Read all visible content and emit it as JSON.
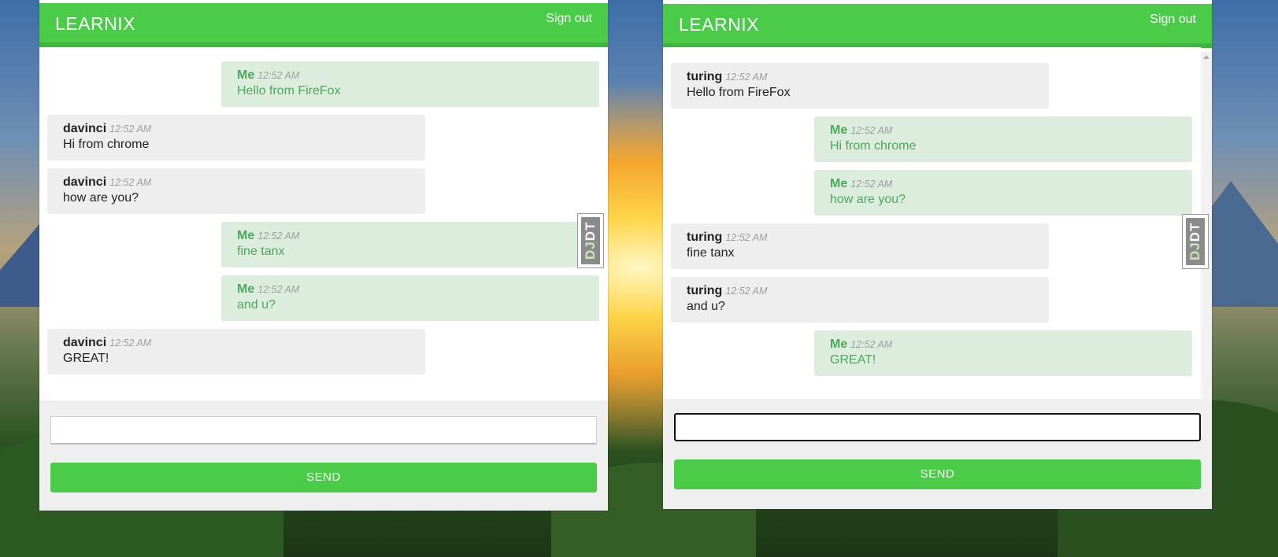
{
  "left_window": {
    "brand": "LEARNIX",
    "signout_label": "Sign out",
    "messages": [
      {
        "sender": "Me",
        "time": "12:52 AM",
        "text": "Hello from FireFox"
      },
      {
        "sender": "davinci",
        "time": "12:52 AM",
        "text": "Hi from chrome"
      },
      {
        "sender": "davinci",
        "time": "12:52 AM",
        "text": "how are you?"
      },
      {
        "sender": "Me",
        "time": "12:52 AM",
        "text": "fine tanx"
      },
      {
        "sender": "Me",
        "time": "12:52 AM",
        "text": "and u?"
      },
      {
        "sender": "davinci",
        "time": "12:52 AM",
        "text": "GREAT!"
      }
    ],
    "input_value": "",
    "send_label": "SEND"
  },
  "right_window": {
    "brand": "LEARNIX",
    "signout_label": "Sign out",
    "messages": [
      {
        "sender": "turing",
        "time": "12:52 AM",
        "text": "Hello from FireFox"
      },
      {
        "sender": "Me",
        "time": "12:52 AM",
        "text": "Hi from chrome"
      },
      {
        "sender": "Me",
        "time": "12:52 AM",
        "text": "how are you?"
      },
      {
        "sender": "turing",
        "time": "12:52 AM",
        "text": "fine tanx"
      },
      {
        "sender": "turing",
        "time": "12:52 AM",
        "text": "and u?"
      },
      {
        "sender": "Me",
        "time": "12:52 AM",
        "text": "GREAT!"
      }
    ],
    "input_value": "",
    "send_label": "SEND"
  },
  "debug_toolbar": {
    "label_dj": "DJ",
    "label_dt": "DT"
  },
  "colors": {
    "accent_green": "#4bcc48",
    "me_bubble": "#dcecdd",
    "other_bubble": "#eeeeee"
  }
}
